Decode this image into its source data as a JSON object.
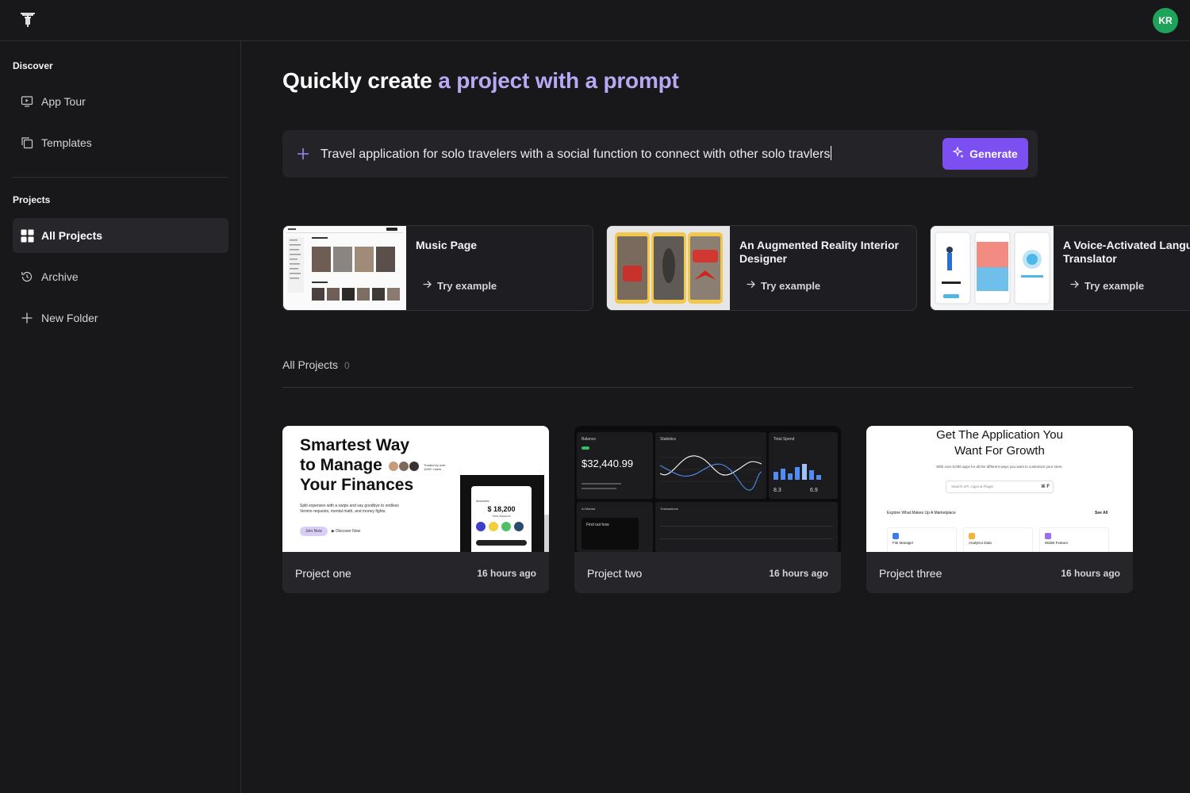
{
  "topbar": {
    "avatar_initials": "KR",
    "avatar_color": "#1fa35a"
  },
  "sidebar": {
    "discover_title": "Discover",
    "discover_items": [
      {
        "label": "App Tour",
        "icon": "monitor-play-icon"
      },
      {
        "label": "Templates",
        "icon": "copy-icon"
      }
    ],
    "projects_title": "Projects",
    "project_items": [
      {
        "label": "All Projects",
        "icon": "grid-icon",
        "active": true
      },
      {
        "label": "Archive",
        "icon": "history-icon"
      },
      {
        "label": "New Folder",
        "icon": "plus-icon"
      }
    ]
  },
  "main": {
    "headline_plain": "Quickly create",
    "headline_accent": "a project with a prompt",
    "prompt": {
      "value": "Travel application for solo travelers with a social function to connect with other solo travlers",
      "generate_label": "Generate"
    },
    "examples": [
      {
        "title": "Music Page",
        "try_label": "Try example"
      },
      {
        "title": "An Augmented Reality Interior Designer",
        "try_label": "Try example"
      },
      {
        "title": "A Voice-Activated Language Translator",
        "try_label": "Try example"
      }
    ],
    "all_projects_label": "All Projects",
    "all_projects_count": "0",
    "projects": [
      {
        "name": "Project one",
        "time": "16 hours ago",
        "preview": {
          "headline": [
            "Smartest Way",
            "to Manage",
            "Your Finances"
          ],
          "trusted": "Trusted by over 1000+ users",
          "body": "Split expenses with a swipe and say goodbye to endless Venmo requests, mental math, and money fights.",
          "join": "Join Now",
          "discover": "Discover Now",
          "phone_label": "Accounts",
          "phone_amount": "$ 18,200",
          "phone_sub": "Total Balance"
        }
      },
      {
        "name": "Project two",
        "time": "16 hours ago",
        "preview": {
          "balance_label": "Balance",
          "balance": "$32,440.99",
          "stats_label": "Statistics",
          "spend_label": "Total Spend",
          "spend_a": "8.3",
          "spend_b": "6.9",
          "ai_label": "AI Mantra",
          "ai_text": "Find out how",
          "transactions_label": "Transactions"
        }
      },
      {
        "name": "Project three",
        "time": "16 hours ago",
        "preview": {
          "headline": [
            "Get The Application You",
            "Want For Growth"
          ],
          "sub": "With over 8,000 apps for all the different ways you want to customize your store.",
          "search": "Search API, Apps & Plugin",
          "search_kbd": "⌘ F",
          "explore": "Explore What Makes Up A Marketplace",
          "see_all": "See All",
          "apps": [
            "File Manager",
            "Analytics Data",
            "Wallet Feature"
          ]
        }
      }
    ]
  },
  "colors": {
    "accent": "#b9a8f3",
    "button": "#7b4ff0",
    "background": "#18181b"
  }
}
